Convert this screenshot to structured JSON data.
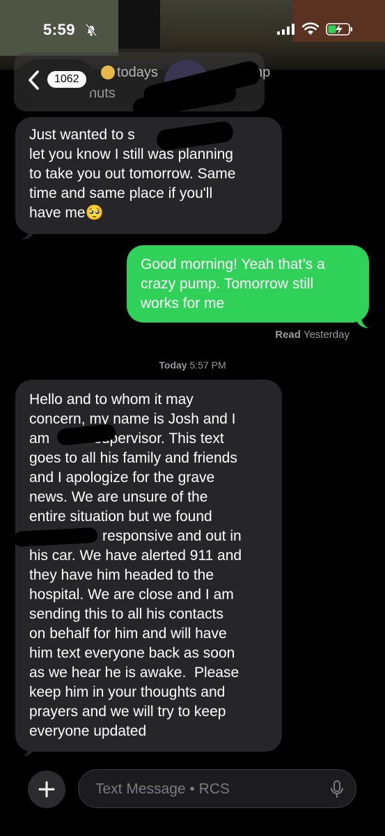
{
  "status_bar": {
    "time": "5:59",
    "icons": [
      "bell-slash-icon",
      "signal-icon",
      "wifi-icon",
      "battery-charging-icon"
    ]
  },
  "header": {
    "back_icon": "chevron-left-icon",
    "unread_count": "1062",
    "contact_preview_line1": "todays",
    "contact_preview_line1_tail": "mp",
    "contact_preview_line2": "nuts"
  },
  "messages": [
    {
      "direction": "incoming",
      "text": "Just wanted to s          so to\nlet you know I still was planning\nto take you out tomorrow. Same\ntime and same place if you'll\nhave me🥺"
    },
    {
      "direction": "outgoing",
      "text": "Good morning! Yeah that’s a\ncrazy pump. Tomorrow still\nworks for me"
    },
    {
      "direction": "incoming",
      "text": "Hello and to whom it may\nconcern, my name is Josh and I\nam           supervisor. This text\ngoes to all his family and friends\nand I apologize for the grave\nnews. We are unsure of the\nentire situation but we found\n                  responsive and out in\nhis car. We have alerted 911 and\nthey have him headed to the\nhospital. We are close and I am\nsending this to all his contacts\non behalf for him and will have\nhim text everyone back as soon\nas we hear he is awake.  Please\nkeep him in your thoughts and\nprayers and we will try to keep\neveryone updated"
    }
  ],
  "read_receipt": {
    "label": "Read",
    "when": "Yesterday"
  },
  "day_separator": {
    "day": "Today",
    "time": "5:57 PM"
  },
  "composer": {
    "plus_icon": "plus-icon",
    "placeholder": "Text Message • RCS",
    "mic_icon": "microphone-icon"
  },
  "colors": {
    "incoming_bubble": "#262629",
    "outgoing_bubble": "#30d158",
    "background": "#000000"
  }
}
